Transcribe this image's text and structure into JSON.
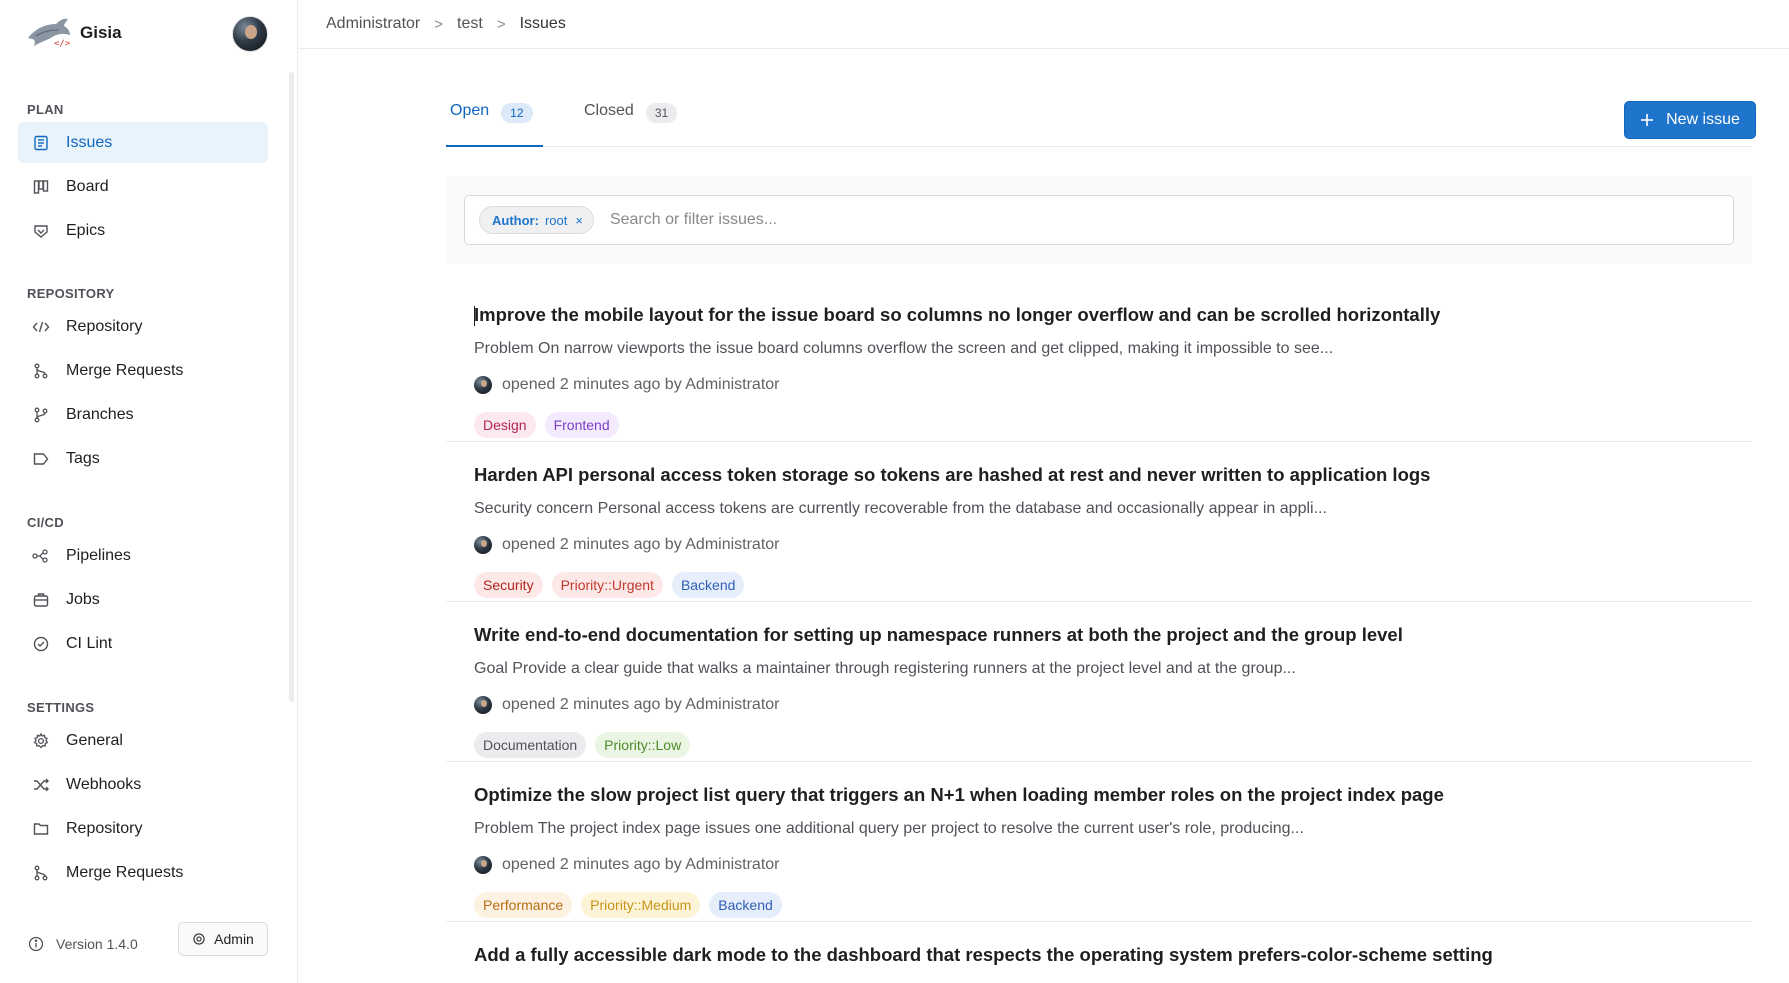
{
  "app": {
    "name": "Gisia"
  },
  "sidebar": {
    "sections": [
      {
        "title": "PLAN",
        "items": [
          {
            "label": "Issues",
            "icon": "issues-icon",
            "active": true
          },
          {
            "label": "Board",
            "icon": "board-icon"
          },
          {
            "label": "Epics",
            "icon": "epic-icon"
          }
        ]
      },
      {
        "title": "REPOSITORY",
        "items": [
          {
            "label": "Repository",
            "icon": "code-icon"
          },
          {
            "label": "Merge Requests",
            "icon": "merge-request-icon"
          },
          {
            "label": "Branches",
            "icon": "branch-icon"
          },
          {
            "label": "Tags",
            "icon": "tag-icon"
          }
        ]
      },
      {
        "title": "CI/CD",
        "items": [
          {
            "label": "Pipelines",
            "icon": "pipeline-icon"
          },
          {
            "label": "Jobs",
            "icon": "jobs-icon"
          },
          {
            "label": "CI Lint",
            "icon": "check-circle-icon"
          }
        ]
      },
      {
        "title": "SETTINGS",
        "items": [
          {
            "label": "General",
            "icon": "gear-icon"
          },
          {
            "label": "Webhooks",
            "icon": "webhook-icon"
          },
          {
            "label": "Repository",
            "icon": "folder-icon"
          },
          {
            "label": "Merge Requests",
            "icon": "merge-request-icon"
          }
        ]
      }
    ],
    "footer": {
      "version": "Version 1.4.0",
      "admin_label": "Admin"
    }
  },
  "breadcrumb": [
    "Administrator",
    "test",
    "Issues"
  ],
  "breadcrumb_separator": ">",
  "tabs": [
    {
      "label": "Open",
      "count": "12",
      "active": true
    },
    {
      "label": "Closed",
      "count": "31",
      "active": false
    }
  ],
  "new_issue_label": "New issue",
  "filter": {
    "token_key": "Author:",
    "token_value": "root",
    "token_remove": "×",
    "placeholder": "Search or filter issues..."
  },
  "issues": [
    {
      "title": "Improve the mobile layout for the issue board so columns no longer overflow and can be scrolled horizontally",
      "description": "Problem On narrow viewports the issue board columns overflow the screen and get clipped, making it impossible to see...",
      "meta": "opened 2 minutes ago by Administrator",
      "labels": [
        {
          "text": "Design",
          "style": "design"
        },
        {
          "text": "Frontend",
          "style": "frontend"
        }
      ]
    },
    {
      "title": "Harden API personal access token storage so tokens are hashed at rest and never written to application logs",
      "description": "Security concern Personal access tokens are currently recoverable from the database and occasionally appear in appli...",
      "meta": "opened 2 minutes ago by Administrator",
      "labels": [
        {
          "text": "Security",
          "style": "security"
        },
        {
          "text": "Priority::Urgent",
          "style": "urgent"
        },
        {
          "text": "Backend",
          "style": "backend"
        }
      ]
    },
    {
      "title": "Write end-to-end documentation for setting up namespace runners at both the project and the group level",
      "description": "Goal Provide a clear guide that walks a maintainer through registering runners at the project level and at the group...",
      "meta": "opened 2 minutes ago by Administrator",
      "labels": [
        {
          "text": "Documentation",
          "style": "docs"
        },
        {
          "text": "Priority::Low",
          "style": "low"
        }
      ]
    },
    {
      "title": "Optimize the slow project list query that triggers an N+1 when loading member roles on the project index page",
      "description": "Problem The project index page issues one additional query per project to resolve the current user's role, producing...",
      "meta": "opened 2 minutes ago by Administrator",
      "labels": [
        {
          "text": "Performance",
          "style": "perf"
        },
        {
          "text": "Priority::Medium",
          "style": "medium"
        },
        {
          "text": "Backend",
          "style": "backend"
        }
      ]
    },
    {
      "title": "Add a fully accessible dark mode to the dashboard that respects the operating system prefers-color-scheme setting",
      "description": "",
      "meta": "",
      "labels": []
    }
  ],
  "colors": {
    "accent": "#1068bf",
    "button": "#1f75cb"
  }
}
